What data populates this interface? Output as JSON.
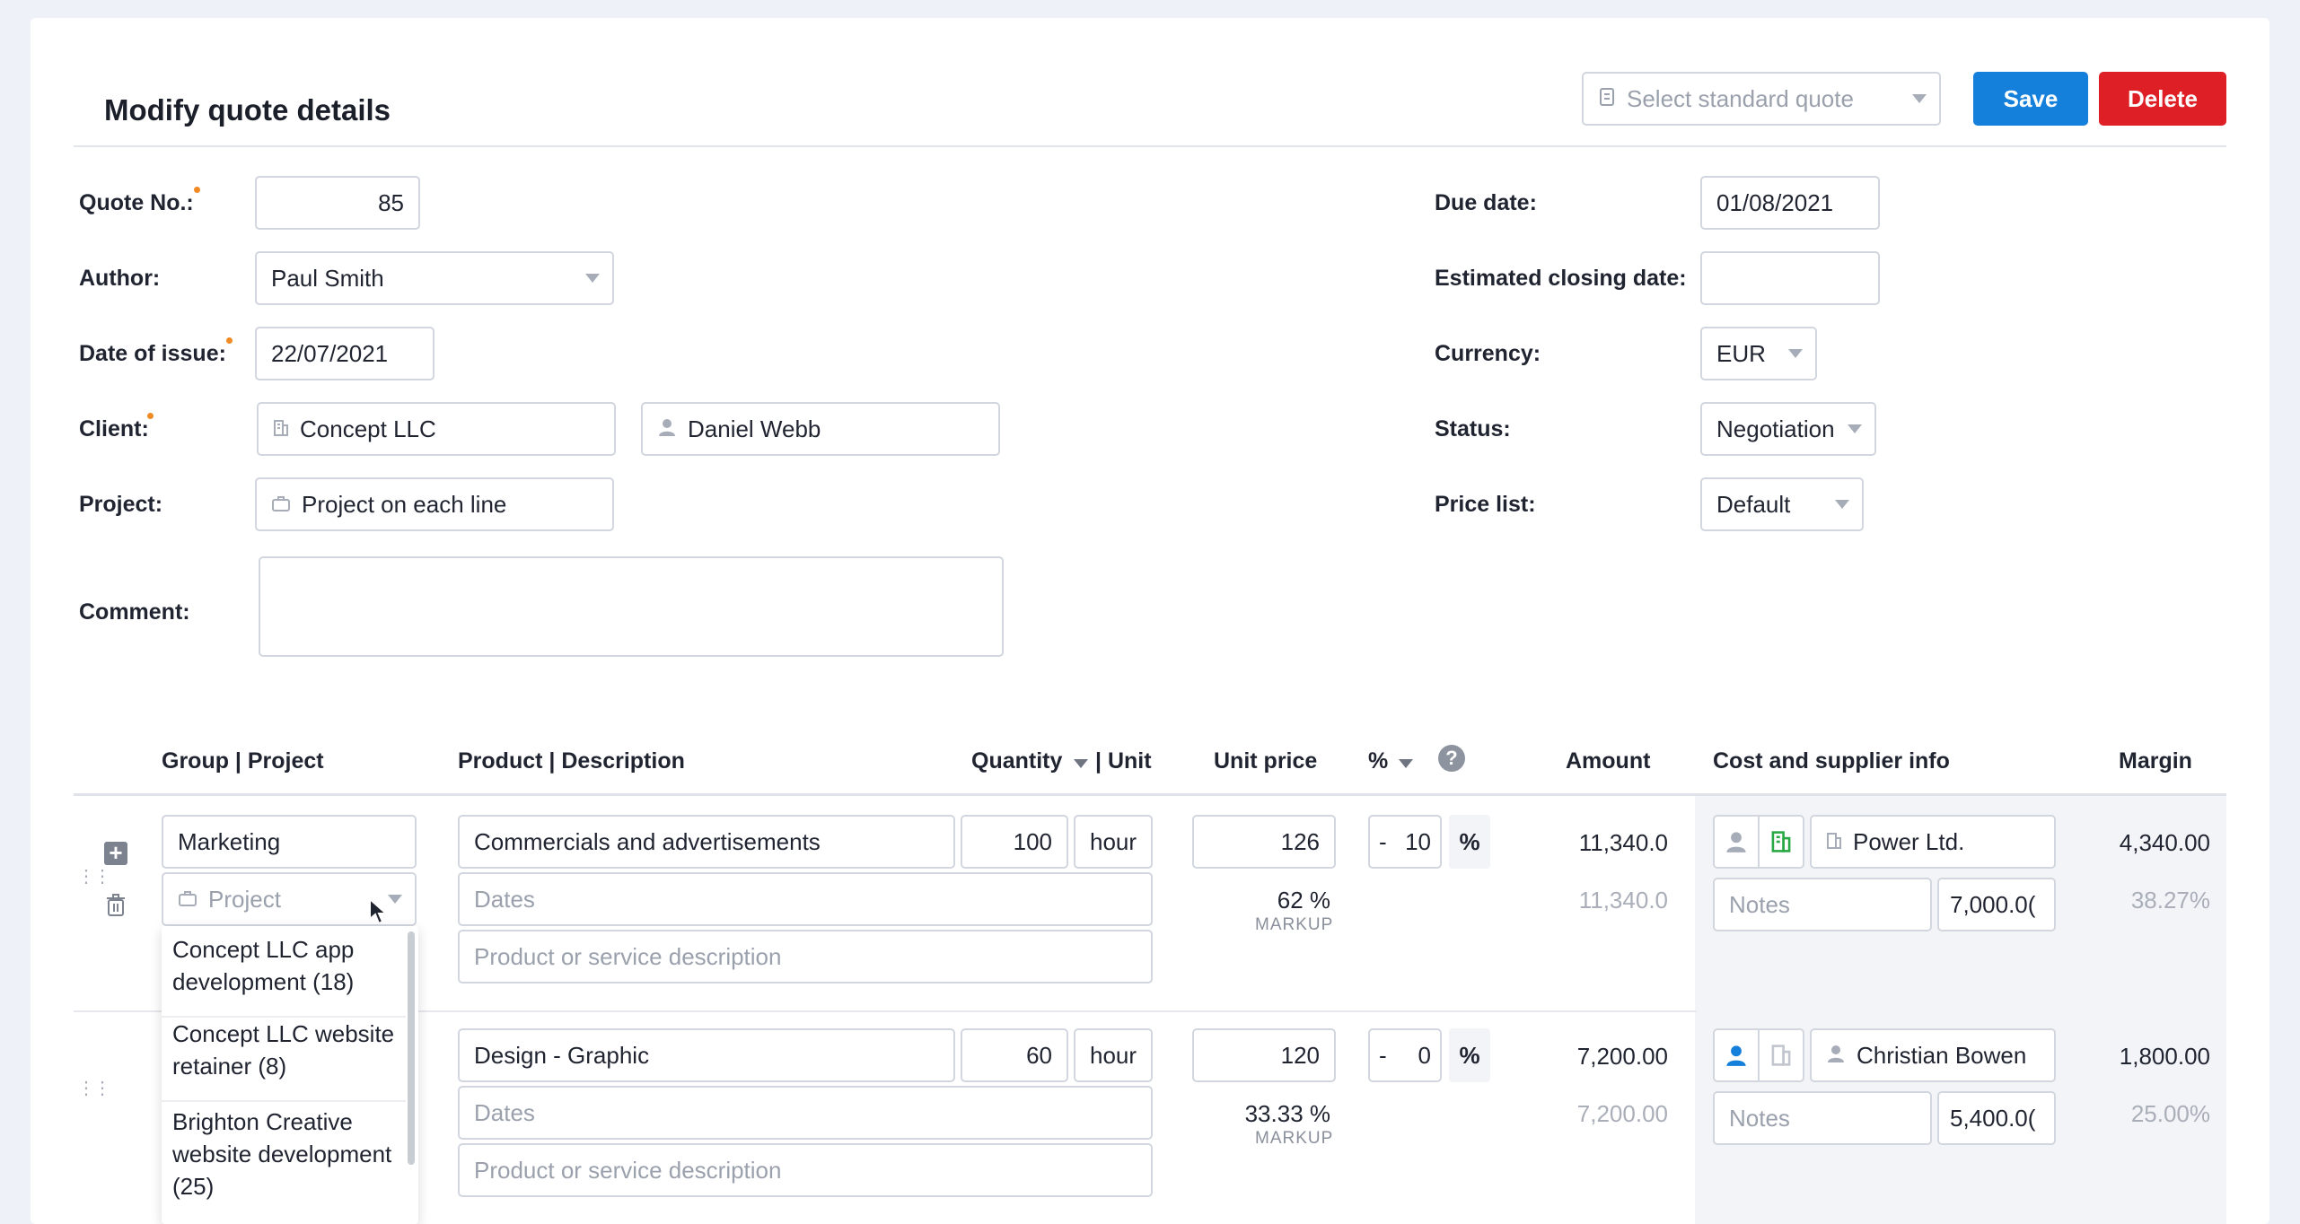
{
  "header": {
    "title": "Modify quote details",
    "standard_quote_placeholder": "Select standard quote",
    "save_label": "Save",
    "delete_label": "Delete"
  },
  "form": {
    "quote_no_label": "Quote No.:",
    "quote_no": "85",
    "author_label": "Author:",
    "author": "Paul Smith",
    "date_issue_label": "Date of issue:",
    "date_issue": "22/07/2021",
    "client_label": "Client:",
    "client_company": "Concept LLC",
    "client_contact": "Daniel Webb",
    "project_label": "Project:",
    "project": "Project on each line",
    "comment_label": "Comment:",
    "comment": "",
    "due_date_label": "Due date:",
    "due_date": "01/08/2021",
    "est_closing_label": "Estimated closing date:",
    "est_closing": "",
    "currency_label": "Currency:",
    "currency": "EUR",
    "status_label": "Status:",
    "status": "Negotiation",
    "price_list_label": "Price list:",
    "price_list": "Default"
  },
  "table": {
    "headers": {
      "group_project": "Group | Project",
      "product_description": "Product | Description",
      "quantity": "Quantity",
      "unit": "| Unit",
      "unit_price": "Unit price",
      "percent": "%",
      "amount": "Amount",
      "cost_supplier": "Cost and supplier info",
      "margin": "Margin"
    },
    "rows": [
      {
        "group": "Marketing",
        "project_placeholder": "Project",
        "product": "Commercials and advertisements",
        "quantity": "100",
        "unit": "hour",
        "unit_price": "126",
        "discount_sign": "-",
        "discount": "10",
        "discount_unit": "%",
        "amount": "11,340.0",
        "amount_sub": "11,340.0",
        "dates_placeholder": "Dates",
        "description_placeholder": "Product or service description",
        "markup": "62 %",
        "markup_label": "MARKUP",
        "supplier": "Power Ltd.",
        "notes_placeholder": "Notes",
        "cost": "7,000.0(",
        "margin": "4,340.00",
        "margin_pct": "38.27%"
      },
      {
        "product": "Design - Graphic",
        "quantity": "60",
        "unit": "hour",
        "unit_price": "120",
        "discount_sign": "-",
        "discount": "0",
        "discount_unit": "%",
        "amount": "7,200.00",
        "amount_sub": "7,200.00",
        "dates_placeholder": "Dates",
        "description_placeholder": "Product or service description",
        "markup": "33.33 %",
        "markup_label": "MARKUP",
        "supplier": "Christian Bowen",
        "notes_placeholder": "Notes",
        "cost": "5,400.0(",
        "margin": "1,800.00",
        "margin_pct": "25.00%"
      }
    ]
  },
  "project_dropdown": {
    "options": [
      "Concept LLC app development (18)",
      "Concept LLC website retainer (8)",
      "Brighton Creative website development (25)"
    ]
  },
  "colors": {
    "save": "#1580dc",
    "delete": "#df1f26",
    "required_dot": "#f08a24"
  }
}
